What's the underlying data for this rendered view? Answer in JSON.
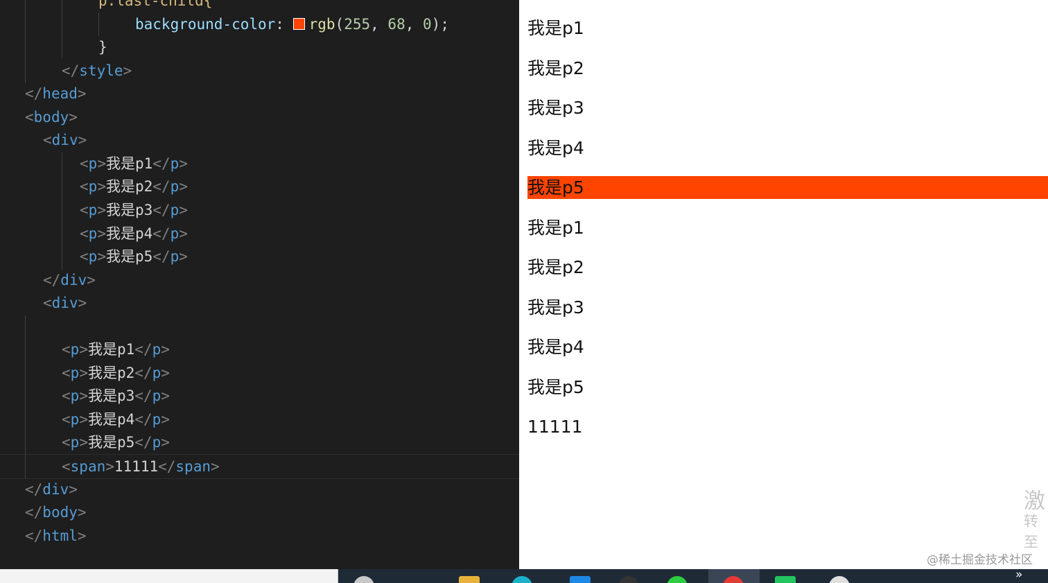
{
  "editor": {
    "lines": [
      {
        "i": 142,
        "segs": [
          [
            "sel",
            "p:last-child{"
          ]
        ]
      },
      {
        "i": 195,
        "segs": [
          [
            "prop",
            "background-color"
          ],
          [
            "txt",
            ": "
          ],
          [
            "swatch",
            ""
          ],
          [
            "fn",
            "rgb"
          ],
          [
            "txt",
            "("
          ],
          [
            "num",
            "255"
          ],
          [
            "txt",
            ", "
          ],
          [
            "num",
            "68"
          ],
          [
            "txt",
            ", "
          ],
          [
            "num",
            "0"
          ],
          [
            "txt",
            ");"
          ]
        ]
      },
      {
        "i": 142,
        "segs": [
          [
            "txt",
            "}"
          ]
        ]
      },
      {
        "i": 89,
        "segs": [
          [
            "br",
            "</"
          ],
          [
            "tag",
            "style"
          ],
          [
            "br",
            ">"
          ]
        ]
      },
      {
        "i": 36,
        "segs": [
          [
            "br",
            "</"
          ],
          [
            "tag",
            "head"
          ],
          [
            "br",
            ">"
          ]
        ]
      },
      {
        "i": 36,
        "segs": [
          [
            "br",
            "<"
          ],
          [
            "tag",
            "body"
          ],
          [
            "br",
            ">"
          ]
        ]
      },
      {
        "i": 62,
        "segs": [
          [
            "br",
            "<"
          ],
          [
            "tag",
            "div"
          ],
          [
            "br",
            ">"
          ]
        ]
      },
      {
        "i": 115,
        "segs": [
          [
            "br",
            "<"
          ],
          [
            "tag",
            "p"
          ],
          [
            "br",
            ">"
          ],
          [
            "cjk",
            "我是"
          ],
          [
            "txt",
            "p1"
          ],
          [
            "br",
            "</"
          ],
          [
            "tag",
            "p"
          ],
          [
            "br",
            ">"
          ]
        ]
      },
      {
        "i": 115,
        "segs": [
          [
            "br",
            "<"
          ],
          [
            "tag",
            "p"
          ],
          [
            "br",
            ">"
          ],
          [
            "cjk",
            "我是"
          ],
          [
            "txt",
            "p2"
          ],
          [
            "br",
            "</"
          ],
          [
            "tag",
            "p"
          ],
          [
            "br",
            ">"
          ]
        ]
      },
      {
        "i": 115,
        "segs": [
          [
            "br",
            "<"
          ],
          [
            "tag",
            "p"
          ],
          [
            "br",
            ">"
          ],
          [
            "cjk",
            "我是"
          ],
          [
            "txt",
            "p3"
          ],
          [
            "br",
            "</"
          ],
          [
            "tag",
            "p"
          ],
          [
            "br",
            ">"
          ]
        ]
      },
      {
        "i": 115,
        "segs": [
          [
            "br",
            "<"
          ],
          [
            "tag",
            "p"
          ],
          [
            "br",
            ">"
          ],
          [
            "cjk",
            "我是"
          ],
          [
            "txt",
            "p4"
          ],
          [
            "br",
            "</"
          ],
          [
            "tag",
            "p"
          ],
          [
            "br",
            ">"
          ]
        ]
      },
      {
        "i": 115,
        "segs": [
          [
            "br",
            "<"
          ],
          [
            "tag",
            "p"
          ],
          [
            "br",
            ">"
          ],
          [
            "cjk",
            "我是"
          ],
          [
            "txt",
            "p5"
          ],
          [
            "br",
            "</"
          ],
          [
            "tag",
            "p"
          ],
          [
            "br",
            ">"
          ]
        ]
      },
      {
        "i": 62,
        "segs": [
          [
            "br",
            "</"
          ],
          [
            "tag",
            "div"
          ],
          [
            "br",
            ">"
          ]
        ]
      },
      {
        "i": 62,
        "segs": [
          [
            "br",
            "<"
          ],
          [
            "tag",
            "div"
          ],
          [
            "br",
            ">"
          ]
        ]
      },
      {
        "i": 0,
        "segs": []
      },
      {
        "i": 89,
        "segs": [
          [
            "br",
            "<"
          ],
          [
            "tag",
            "p"
          ],
          [
            "br",
            ">"
          ],
          [
            "cjk",
            "我是"
          ],
          [
            "txt",
            "p1"
          ],
          [
            "br",
            "</"
          ],
          [
            "tag",
            "p"
          ],
          [
            "br",
            ">"
          ]
        ]
      },
      {
        "i": 89,
        "segs": [
          [
            "br",
            "<"
          ],
          [
            "tag",
            "p"
          ],
          [
            "br",
            ">"
          ],
          [
            "cjk",
            "我是"
          ],
          [
            "txt",
            "p2"
          ],
          [
            "br",
            "</"
          ],
          [
            "tag",
            "p"
          ],
          [
            "br",
            ">"
          ]
        ]
      },
      {
        "i": 89,
        "segs": [
          [
            "br",
            "<"
          ],
          [
            "tag",
            "p"
          ],
          [
            "br",
            ">"
          ],
          [
            "cjk",
            "我是"
          ],
          [
            "txt",
            "p3"
          ],
          [
            "br",
            "</"
          ],
          [
            "tag",
            "p"
          ],
          [
            "br",
            ">"
          ]
        ]
      },
      {
        "i": 89,
        "segs": [
          [
            "br",
            "<"
          ],
          [
            "tag",
            "p"
          ],
          [
            "br",
            ">"
          ],
          [
            "cjk",
            "我是"
          ],
          [
            "txt",
            "p4"
          ],
          [
            "br",
            "</"
          ],
          [
            "tag",
            "p"
          ],
          [
            "br",
            ">"
          ]
        ]
      },
      {
        "i": 89,
        "segs": [
          [
            "br",
            "<"
          ],
          [
            "tag",
            "p"
          ],
          [
            "br",
            ">"
          ],
          [
            "cjk",
            "我是"
          ],
          [
            "txt",
            "p5"
          ],
          [
            "br",
            "</"
          ],
          [
            "tag",
            "p"
          ],
          [
            "br",
            ">"
          ]
        ]
      },
      {
        "i": 89,
        "current": true,
        "segs": [
          [
            "br",
            "<"
          ],
          [
            "tag",
            "span"
          ],
          [
            "br",
            ">"
          ],
          [
            "txt",
            "11111"
          ],
          [
            "br",
            "</"
          ],
          [
            "tag",
            "span"
          ],
          [
            "br",
            ">"
          ]
        ]
      },
      {
        "i": 36,
        "segs": [
          [
            "br",
            "</"
          ],
          [
            "tag",
            "div"
          ],
          [
            "br",
            ">"
          ]
        ]
      },
      {
        "i": 36,
        "segs": [
          [
            "br",
            "</"
          ],
          [
            "tag",
            "body"
          ],
          [
            "br",
            ">"
          ]
        ]
      },
      {
        "i": 36,
        "segs": [
          [
            "br",
            "</"
          ],
          [
            "tag",
            "html"
          ],
          [
            "br",
            ">"
          ]
        ]
      }
    ]
  },
  "preview": {
    "items": [
      {
        "text": "我是p1"
      },
      {
        "text": "我是p2"
      },
      {
        "text": "我是p3"
      },
      {
        "text": "我是p4"
      },
      {
        "text": "我是p5",
        "highlighted": true
      },
      {
        "text": "我是p1"
      },
      {
        "text": "我是p2"
      },
      {
        "text": "我是p3"
      },
      {
        "text": "我是p4"
      },
      {
        "text": "我是p5"
      },
      {
        "text": "11111"
      }
    ],
    "highlight_color": "#ff4400",
    "watermark_line1": "激",
    "watermark_line2": "转至",
    "credit": "@稀土掘金技术社区"
  },
  "taskbar": {
    "icons": [
      {
        "name": "search-circle-icon",
        "color": "#c8c8c8"
      },
      {
        "name": "file-explorer-icon",
        "color": "#e8b23a"
      },
      {
        "name": "edge-browser-icon",
        "color": "#1bb2c9"
      },
      {
        "name": "vscode-icon",
        "color": "#1e88e5"
      },
      {
        "name": "app-icon",
        "color": "#333333"
      },
      {
        "name": "chat-app-icon",
        "color": "#2ecc40"
      },
      {
        "name": "chrome-icon",
        "color": "#e53935"
      },
      {
        "name": "green-app-icon",
        "color": "#22c55e"
      },
      {
        "name": "white-app-icon",
        "color": "#e0e0e0"
      }
    ],
    "overflow_glyph": "»"
  }
}
